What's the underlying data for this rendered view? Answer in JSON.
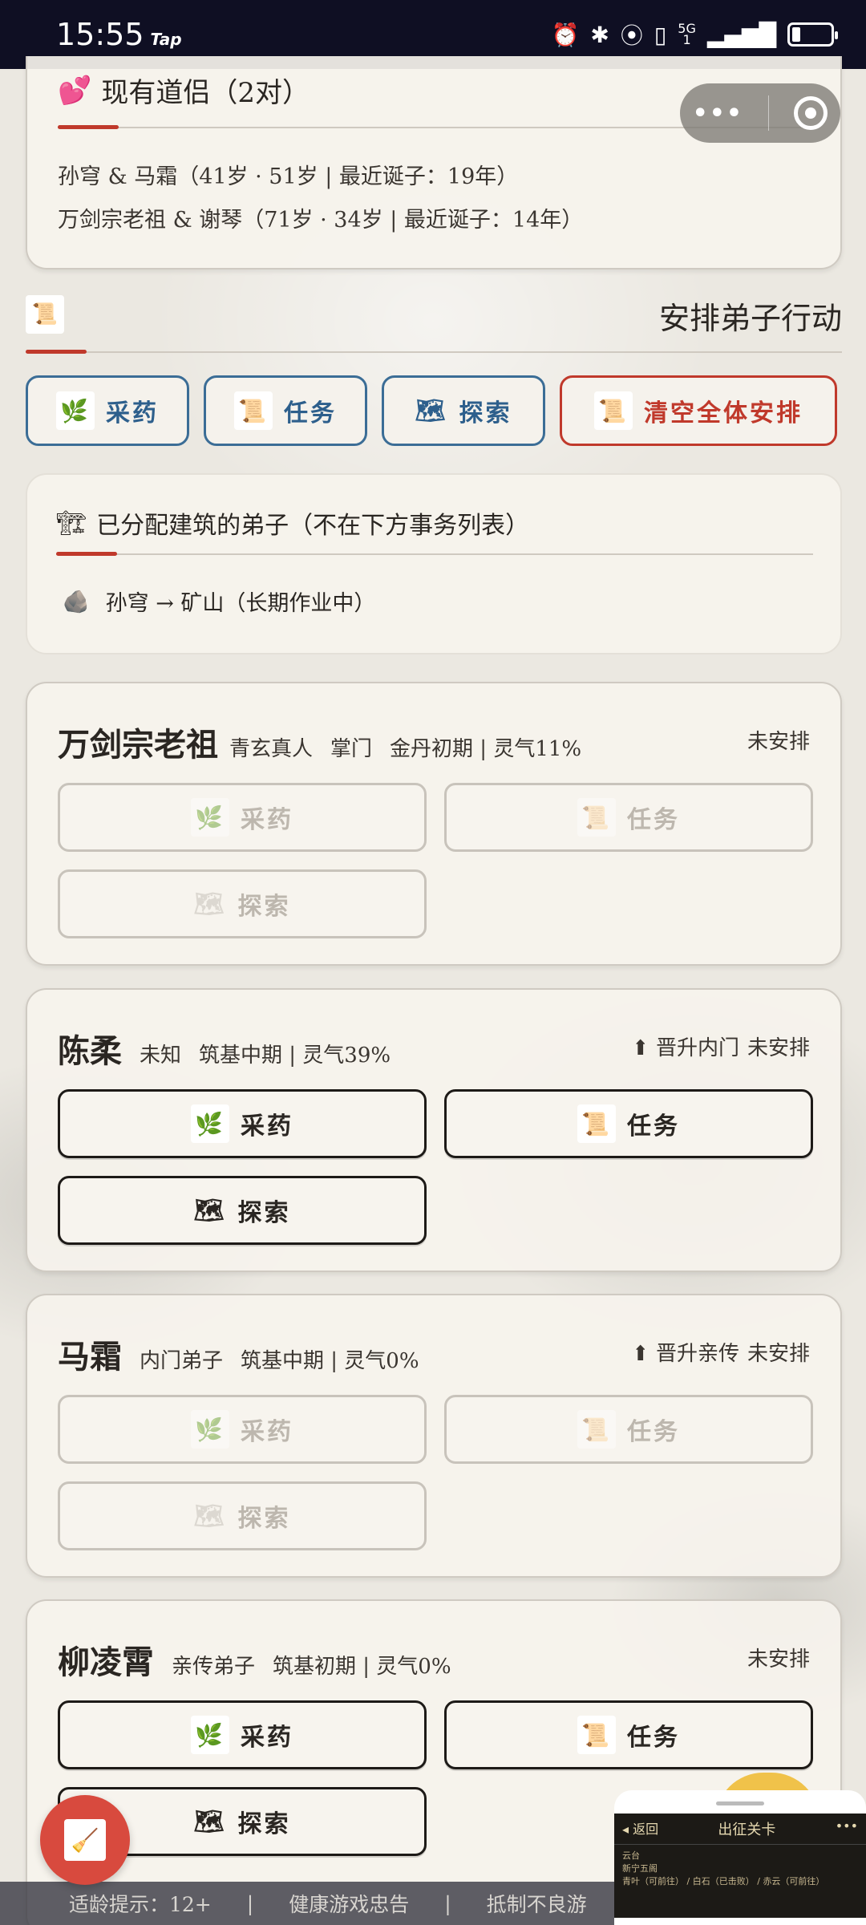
{
  "status_bar": {
    "time": "15:55",
    "tap": "Tap",
    "icons": [
      "alarm-icon",
      "bluetooth-icon",
      "location-icon",
      "vibrate-icon",
      "5g-signal-icon",
      "battery-icon"
    ],
    "net_top": "5G",
    "net_bottom": "1",
    "signal": "▂▄▆█"
  },
  "capsule": {
    "more": "•••"
  },
  "partners": {
    "icon": "💕",
    "title": "现有道侣（2对）",
    "lines": [
      "孙穹 & 马霜（41岁 · 51岁 | 最近诞子：19年）",
      "万剑宗老祖 & 谢琴（71岁 · 34岁 | 最近诞子：14年）"
    ]
  },
  "arrange": {
    "icon": "📜",
    "title": "安排弟子行动",
    "buttons": [
      {
        "icon": "🌿",
        "label": "采药"
      },
      {
        "icon": "📜",
        "label": "任务"
      },
      {
        "icon": "🗺",
        "label": "探索"
      },
      {
        "icon": "📜",
        "label": "清空全体安排"
      }
    ]
  },
  "buildings": {
    "icon": "🏗",
    "title": "已分配建筑的弟子（不在下方事务列表）",
    "items": [
      {
        "icon": "🪨",
        "text": "孙穹 → 矿山（长期作业中）"
      }
    ]
  },
  "disciples": [
    {
      "name": "万剑宗老祖",
      "rank": "青玄真人",
      "role": "掌门",
      "realm": "金丹初期 | 灵气11%",
      "promote": "",
      "status": "未安排",
      "actions": [
        {
          "icon": "🌿",
          "label": "采药"
        },
        {
          "icon": "📜",
          "label": "任务"
        },
        {
          "icon": "🗺",
          "label": "探索"
        }
      ]
    },
    {
      "name": "陈柔",
      "role": "未知",
      "realm": "筑基中期 | 灵气39%",
      "promote": "⬆ 晋升内门",
      "status": "未安排",
      "actions": [
        {
          "icon": "🌿",
          "label": "采药"
        },
        {
          "icon": "📜",
          "label": "任务"
        },
        {
          "icon": "🗺",
          "label": "探索"
        }
      ]
    },
    {
      "name": "马霜",
      "role": "内门弟子",
      "realm": "筑基中期 | 灵气0%",
      "promote": "⬆ 晋升亲传",
      "status": "未安排",
      "actions": [
        {
          "icon": "🌿",
          "label": "采药"
        },
        {
          "icon": "📜",
          "label": "任务"
        },
        {
          "icon": "🗺",
          "label": "探索"
        }
      ]
    },
    {
      "name": "柳凌霄",
      "role": "亲传弟子",
      "realm": "筑基初期 | 灵气0%",
      "promote": "",
      "status": "未安排",
      "actions": [
        {
          "icon": "🌿",
          "label": "采药"
        },
        {
          "icon": "📜",
          "label": "任务"
        },
        {
          "icon": "🗺",
          "label": "探索"
        }
      ]
    }
  ],
  "fab": {
    "icon": "🧹"
  },
  "footer": {
    "age": "适龄提示：12+",
    "sep": "|",
    "health": "健康游戏忠告",
    "resist": "抵制不良游"
  },
  "mini_window": {
    "back": "◂ 返回",
    "title": "出征关卡",
    "more": "•••",
    "text1": "云台",
    "text2": "新宁五阁",
    "text3": "青叶（可前往） / 白石（已击败） / 赤云（可前往）"
  }
}
